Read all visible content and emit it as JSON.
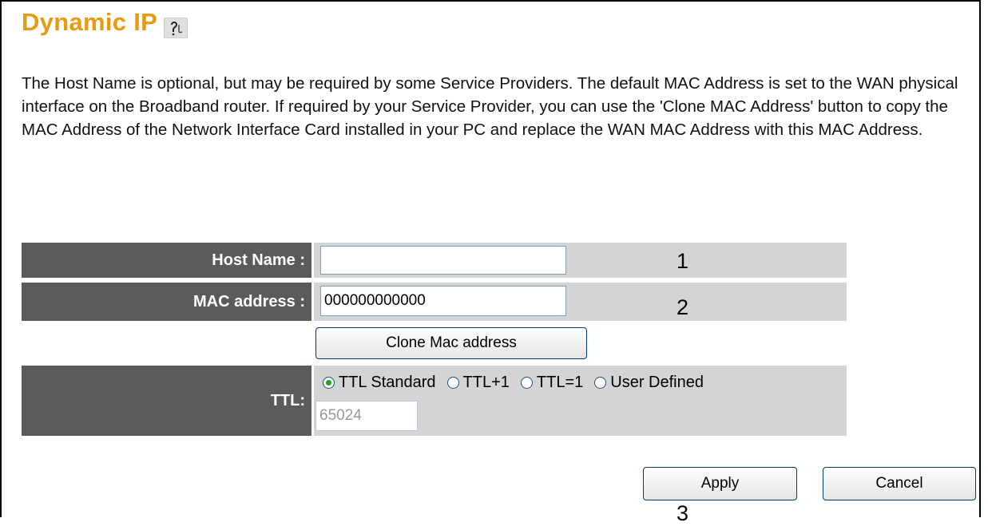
{
  "page": {
    "title": "Dynamic IP",
    "description": "The Host Name is optional, but may be required by some Service Providers. The default MAC Address is set to the WAN physical interface on the Broadband router. If required by your Service Provider, you can use the 'Clone MAC Address' button to copy the MAC Address of the Network Interface Card installed in your PC and replace the WAN MAC Address with this MAC Address."
  },
  "form": {
    "host_name": {
      "label": "Host Name :",
      "value": ""
    },
    "mac_address": {
      "label": "MAC address :",
      "value": "000000000000"
    },
    "clone_button": "Clone Mac address",
    "ttl": {
      "label": "TTL:",
      "options": [
        "TTL Standard",
        "TTL+1",
        "TTL=1",
        "User Defined"
      ],
      "selected": "TTL Standard",
      "value": "65024"
    }
  },
  "actions": {
    "apply": "Apply",
    "cancel": "Cancel"
  },
  "callouts": {
    "one": "1",
    "two": "2",
    "three": "3"
  },
  "colors": {
    "title": "#e89a10",
    "label_bg": "#5b5b5b",
    "value_bg": "#d4d4d4"
  }
}
